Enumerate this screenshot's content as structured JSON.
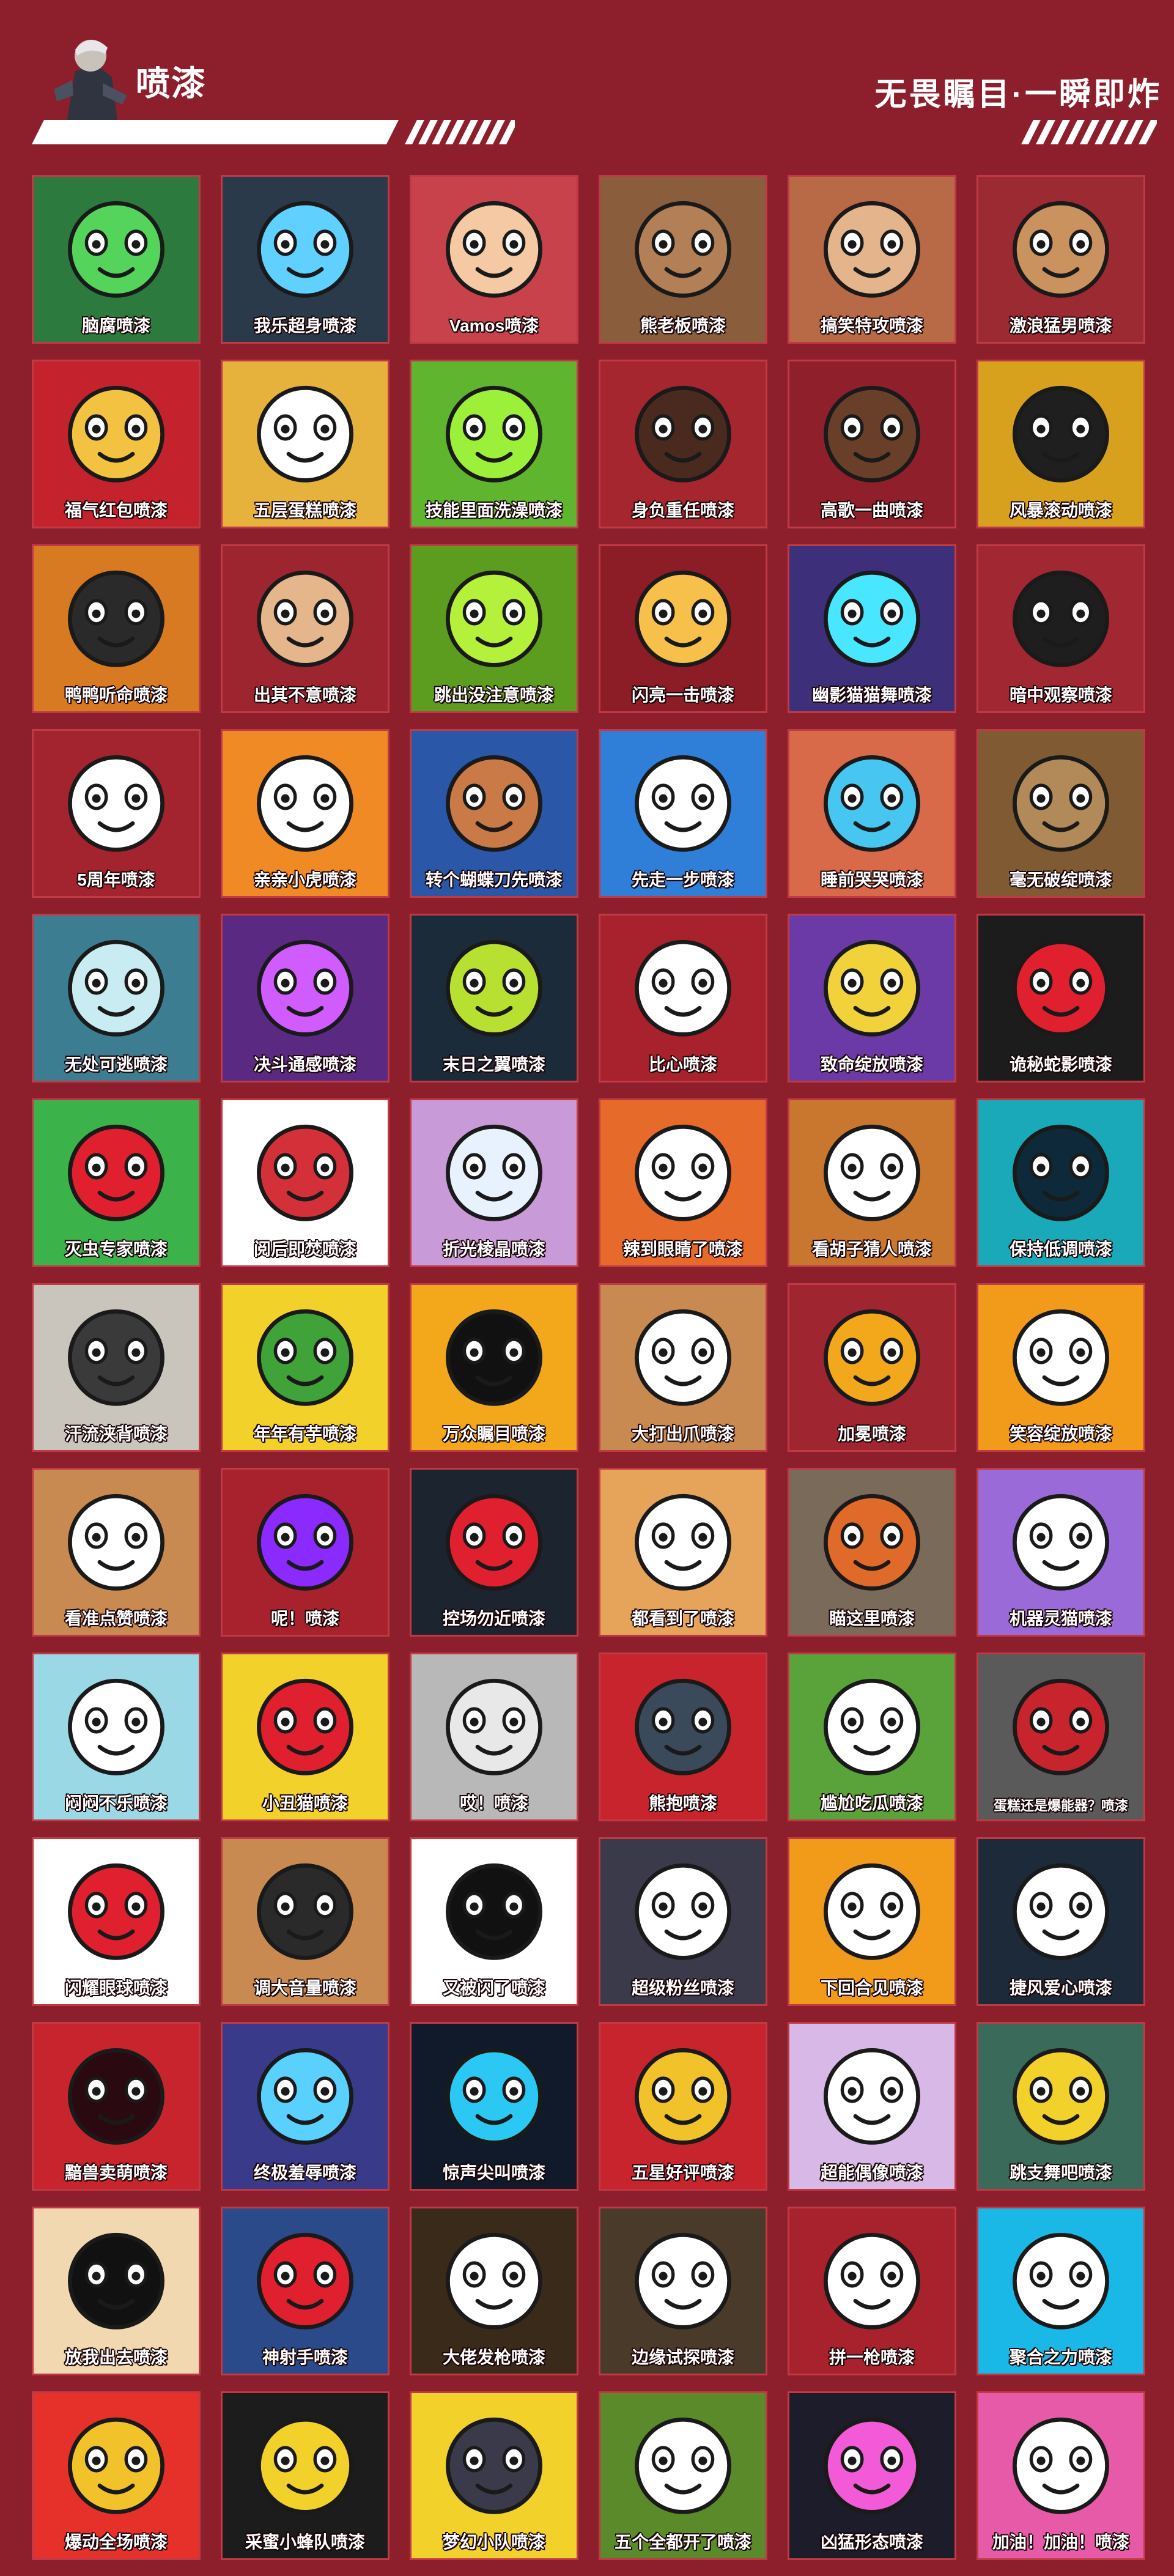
{
  "header": {
    "title": "喷漆",
    "tagline": "无畏瞩目·一瞬即炸",
    "avatar_icon": "agent-portrait-icon"
  },
  "colors": {
    "background": "#8d1f2c",
    "tile_border": "#c03a46",
    "text": "#ffffff"
  },
  "sprays": [
    {
      "label": "脑腐喷漆",
      "icon": "green-blob-face-icon",
      "bg": "#2d7a3e",
      "fg": "#55d45c"
    },
    {
      "label": "我乐超身喷漆",
      "icon": "armored-robot-icon",
      "bg": "#2b3a4a",
      "fg": "#5fd0ff"
    },
    {
      "label": "Vamos喷漆",
      "icon": "laughing-girl-cap-icon",
      "bg": "#c8424c",
      "fg": "#f4c9a4"
    },
    {
      "label": "熊老板喷漆",
      "icon": "bear-sunglasses-icon",
      "bg": "#8a5d3c",
      "fg": "#b27f56"
    },
    {
      "label": "搞笑特攻喷漆",
      "icon": "shocked-chipmunk-icon",
      "bg": "#b76a45",
      "fg": "#e4b58d"
    },
    {
      "label": "激浪猛男喷漆",
      "icon": "muscle-agent-icon",
      "bg": "#9b2a33",
      "fg": "#c9925e"
    },
    {
      "label": "福气红包喷漆",
      "icon": "golden-horse-icon",
      "bg": "#c4222d",
      "fg": "#f2c240"
    },
    {
      "label": "五层蛋糕喷漆",
      "icon": "bear-penguin-icon",
      "bg": "#e6b23c",
      "fg": "#ffffff"
    },
    {
      "label": "技能里面洗澡喷漆",
      "icon": "green-slime-icon",
      "bg": "#5fb52d",
      "fg": "#9cf03a"
    },
    {
      "label": "身负重任喷漆",
      "icon": "dreadlocks-agent-icon",
      "bg": "#a6262f",
      "fg": "#4a2a1e"
    },
    {
      "label": "高歌一曲喷漆",
      "icon": "headphones-singer-icon",
      "bg": "#8f1f2a",
      "fg": "#6a3f2a"
    },
    {
      "label": "风暴滚动喷漆",
      "icon": "hooded-agent-icon",
      "bg": "#d8a11d",
      "fg": "#1f1f1f"
    },
    {
      "label": "鸭鸭听命喷漆",
      "icon": "duck-sunglasses-icon",
      "bg": "#d77a22",
      "fg": "#2a2a2a"
    },
    {
      "label": "出其不意喷漆",
      "icon": "smirking-agent-icon",
      "bg": "#9c2530",
      "fg": "#e5b58b"
    },
    {
      "label": "跳出没注意喷漆",
      "icon": "hexagon-pattern-icon",
      "bg": "#5c9c1f",
      "fg": "#b5f03a"
    },
    {
      "label": "闪亮一击喷漆",
      "icon": "bullet-burst-icon",
      "bg": "#8c1c26",
      "fg": "#f6c04a"
    },
    {
      "label": "幽影猫猫舞喷漆",
      "icon": "shadow-cat-icon",
      "bg": "#3e2f7a",
      "fg": "#48e6ff"
    },
    {
      "label": "暗中观察喷漆",
      "icon": "peeking-agent-icon",
      "bg": "#a12732",
      "fg": "#1e1e1e"
    },
    {
      "label": "5周年喷漆",
      "icon": "candle-number-five-icon",
      "bg": "#a3232e",
      "fg": "#ffffff"
    },
    {
      "label": "亲亲小虎喷漆",
      "icon": "tiger-cub-icon",
      "bg": "#f08a25",
      "fg": "#ffffff"
    },
    {
      "label": "转个蝴蝶刀先喷漆",
      "icon": "blue-hair-agent-icon",
      "bg": "#2a57a8",
      "fg": "#c97a46"
    },
    {
      "label": "先走一步喷漆",
      "icon": "grinning-kid-icon",
      "bg": "#2f7fd8",
      "fg": "#ffffff"
    },
    {
      "label": "睡前哭哭喷漆",
      "icon": "crying-face-icon",
      "bg": "#d86a4a",
      "fg": "#48c6f2"
    },
    {
      "label": "毫无破绽喷漆",
      "icon": "hooded-penguin-icon",
      "bg": "#7f5a33",
      "fg": "#b28a5a"
    },
    {
      "label": "无处可逃喷漆",
      "icon": "shocked-skull-icon",
      "bg": "#3d7d92",
      "fg": "#c8ecf2"
    },
    {
      "label": "决斗通感喷漆",
      "icon": "glowing-eyes-agent-icon",
      "bg": "#5a2a82",
      "fg": "#d05cff"
    },
    {
      "label": "末日之翼喷漆",
      "icon": "dark-emblem-icon",
      "bg": "#1c2b3a",
      "fg": "#b8e030"
    },
    {
      "label": "比心喷漆",
      "icon": "heart-hands-icon",
      "bg": "#a8222d",
      "fg": "#ffffff"
    },
    {
      "label": "致命绽放喷漆",
      "icon": "spiky-orb-icon",
      "bg": "#6b3aa6",
      "fg": "#f2d23a"
    },
    {
      "label": "诡秘蛇影喷漆",
      "icon": "shadow-snake-icon",
      "bg": "#1c1c1c",
      "fg": "#e0202e"
    },
    {
      "label": "灭虫专家喷漆",
      "icon": "no-bugs-icon",
      "bg": "#3bb34a",
      "fg": "#e0202e"
    },
    {
      "label": "阅后即焚喷漆",
      "icon": "lantern-icon",
      "bg": "#ffffff",
      "fg": "#d4303a"
    },
    {
      "label": "折光棱晶喷漆",
      "icon": "prism-shards-icon",
      "bg": "#c99ad8",
      "fg": "#e8f2ff"
    },
    {
      "label": "辣到眼睛了喷漆",
      "icon": "fox-tears-icon",
      "bg": "#e66a2a",
      "fg": "#ffffff"
    },
    {
      "label": "看胡子猜人喷漆",
      "icon": "mustache-mouth-icon",
      "bg": "#c9762e",
      "fg": "#ffffff"
    },
    {
      "label": "保持低调喷漆",
      "icon": "cyan-orb-icon",
      "bg": "#1aa9b8",
      "fg": "#0e2a3a"
    },
    {
      "label": "汗流浃背喷漆",
      "icon": "sweating-seal-icon",
      "bg": "#c9c4bc",
      "fg": "#3a3a3a"
    },
    {
      "label": "年年有芋喷漆",
      "icon": "corn-harvest-icon",
      "bg": "#f2d12a",
      "fg": "#3fa33a"
    },
    {
      "label": "万众瞩目喷漆",
      "icon": "black-sun-icon",
      "bg": "#f2a81a",
      "fg": "#111111"
    },
    {
      "label": "大打出爪喷漆",
      "icon": "angry-hamster-icon",
      "bg": "#c98a52",
      "fg": "#ffffff"
    },
    {
      "label": "加冕喷漆",
      "icon": "crowned-agent-icon",
      "bg": "#9f2530",
      "fg": "#f2a81a"
    },
    {
      "label": "笑容绽放喷漆",
      "icon": "orange-mask-icon",
      "bg": "#f29a1a",
      "fg": "#ffffff"
    },
    {
      "label": "看准点赞喷漆",
      "icon": "thumbs-up-cat-icon",
      "bg": "#c98a52",
      "fg": "#ffffff"
    },
    {
      "label": "呢！喷漆",
      "icon": "purple-scribble-icon",
      "bg": "#a8222d",
      "fg": "#8a2aff"
    },
    {
      "label": "控场勿近喷漆",
      "icon": "chevron-emblem-icon",
      "bg": "#1c2430",
      "fg": "#e0202e"
    },
    {
      "label": "都看到了喷漆",
      "icon": "goggles-agent-icon",
      "bg": "#e6a35a",
      "fg": "#ffffff"
    },
    {
      "label": "瞄这里喷漆",
      "icon": "target-ring-icon",
      "bg": "#7a6a5a",
      "fg": "#e06a2a"
    },
    {
      "label": "机器灵猫喷漆",
      "icon": "purple-cat-icon",
      "bg": "#9a6ad8",
      "fg": "#ffffff"
    },
    {
      "label": "闷闷不乐喷漆",
      "icon": "pouting-girl-icon",
      "bg": "#9ad8e6",
      "fg": "#ffffff"
    },
    {
      "label": "小丑猫喷漆",
      "icon": "clown-face-icon",
      "bg": "#f2d12a",
      "fg": "#e0202e"
    },
    {
      "label": "哎！喷漆",
      "icon": "silver-star-icon",
      "bg": "#b8b8b8",
      "fg": "#e8e8e8"
    },
    {
      "label": "熊抱喷漆",
      "icon": "shouting-gremlin-icon",
      "bg": "#c8242e",
      "fg": "#3a4a5a"
    },
    {
      "label": "尴尬吃瓜喷漆",
      "icon": "snacking-agent-icon",
      "bg": "#5aa33a",
      "fg": "#ffffff"
    },
    {
      "label": "蛋糕还是爆能器？喷漆",
      "icon": "cake-blaster-icon",
      "bg": "#5a5a5a",
      "fg": "#c8242e",
      "small": true
    },
    {
      "label": "闪耀眼球喷漆",
      "icon": "radiant-eye-icon",
      "bg": "#ffffff",
      "fg": "#e0202e"
    },
    {
      "label": "调大音量喷漆",
      "icon": "speaker-icon",
      "bg": "#c98a52",
      "fg": "#2a2a2a"
    },
    {
      "label": "又被闪了喷漆",
      "icon": "stunned-agent-icon",
      "bg": "#ffffff",
      "fg": "#111111"
    },
    {
      "label": "超级粉丝喷漆",
      "icon": "dark-gremlin-icon",
      "bg": "#3a3a4a",
      "fg": "#ffffff"
    },
    {
      "label": "下回合见喷漆",
      "icon": "mohawk-agent-icon",
      "bg": "#f29a1a",
      "fg": "#ffffff"
    },
    {
      "label": "捷风爱心喷漆",
      "icon": "hooded-jett-icon",
      "bg": "#1c2a3a",
      "fg": "#ffffff"
    },
    {
      "label": "黯兽卖萌喷漆",
      "icon": "red-beast-icon",
      "bg": "#c8242e",
      "fg": "#2a0a10"
    },
    {
      "label": "终极羞辱喷漆",
      "icon": "crying-agent-icon",
      "bg": "#3a3a8a",
      "fg": "#5ad0ff"
    },
    {
      "label": "惊声尖叫喷漆",
      "icon": "cyan-claw-icon",
      "bg": "#111a2a",
      "fg": "#2ac8f2"
    },
    {
      "label": "五星好评喷漆",
      "icon": "gold-star-icon",
      "bg": "#c8242e",
      "fg": "#f2c22a"
    },
    {
      "label": "超能偶像喷漆",
      "icon": "winking-idol-icon",
      "bg": "#d8b8e6",
      "fg": "#ffffff"
    },
    {
      "label": "跳支舞吧喷漆",
      "icon": "yellow-shield-face-icon",
      "bg": "#3a6a5a",
      "fg": "#f2d12a"
    },
    {
      "label": "放我出去喷漆",
      "icon": "blonde-agent-icon",
      "bg": "#f2d8b0",
      "fg": "#111111"
    },
    {
      "label": "神射手喷漆",
      "icon": "cap-agent-icon",
      "bg": "#2a4a8a",
      "fg": "#e0202e"
    },
    {
      "label": "大佬发枪喷漆",
      "icon": "sunglasses-grin-icon",
      "bg": "#3a2a1a",
      "fg": "#ffffff"
    },
    {
      "label": "边缘试探喷漆",
      "icon": "bearded-agent-icon",
      "bg": "#4a3a2a",
      "fg": "#ffffff"
    },
    {
      "label": "拼一枪喷漆",
      "icon": "number-ten-icon",
      "bg": "#a8222d",
      "fg": "#ffffff"
    },
    {
      "label": "聚合之力喷漆",
      "icon": "blue-energy-orb-icon",
      "bg": "#1ab8e6",
      "fg": "#ffffff"
    },
    {
      "label": "爆动全场喷漆",
      "icon": "boom-text-icon",
      "bg": "#e6302a",
      "fg": "#f2c22a"
    },
    {
      "label": "采蜜小蜂队喷漆",
      "icon": "bee-icon",
      "bg": "#1c1c1c",
      "fg": "#f2d12a"
    },
    {
      "label": "梦幻小队喷漆",
      "icon": "bandana-gremlin-icon",
      "bg": "#f2d12a",
      "fg": "#3a3a4a"
    },
    {
      "label": "五个全都开了喷漆",
      "icon": "grenade-agent-icon",
      "bg": "#5a8a2a",
      "fg": "#ffffff"
    },
    {
      "label": "凶猛形态喷漆",
      "icon": "pink-jelly-icon",
      "bg": "#1c1c2a",
      "fg": "#f25ad8"
    },
    {
      "label": "加油！加油！喷漆",
      "icon": "cheering-girl-icon",
      "bg": "#e65aa8",
      "fg": "#ffffff"
    }
  ]
}
